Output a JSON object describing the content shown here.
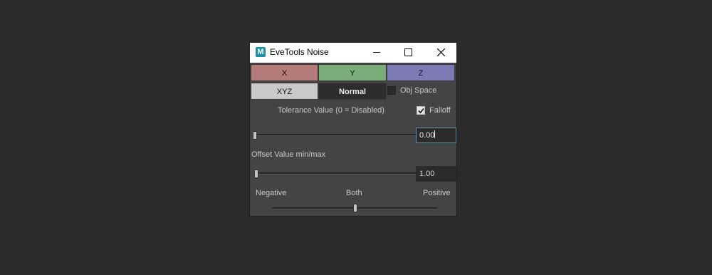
{
  "window": {
    "title": "EveTools Noise",
    "app_icon_letter": "M",
    "minimize_icon": "minimize-icon",
    "maximize_icon": "maximize-icon",
    "close_icon": "close-icon"
  },
  "axes": {
    "x_label": "X",
    "y_label": "Y",
    "z_label": "Z",
    "xyz_label": "XYZ",
    "normal_label": "Normal",
    "colors": {
      "x": "#b57b7b",
      "y": "#7aad7a",
      "z": "#7b7bb5",
      "xyz": "#c9c9c9",
      "normal": "#2d2d2d"
    }
  },
  "obj_space": {
    "label": "Obj Space",
    "checked": false
  },
  "falloff": {
    "label": "Falloff",
    "checked": true
  },
  "tolerance": {
    "label": "Tolerance Value (0 = Disabled)",
    "value": "0.00",
    "slider_fraction": 0
  },
  "offset": {
    "label": "Offset Value min/max",
    "value": "1.00",
    "slider_fraction": 0.01
  },
  "direction": {
    "negative_label": "Negative",
    "both_label": "Both",
    "positive_label": "Positive",
    "slider_fraction": 0.5
  }
}
